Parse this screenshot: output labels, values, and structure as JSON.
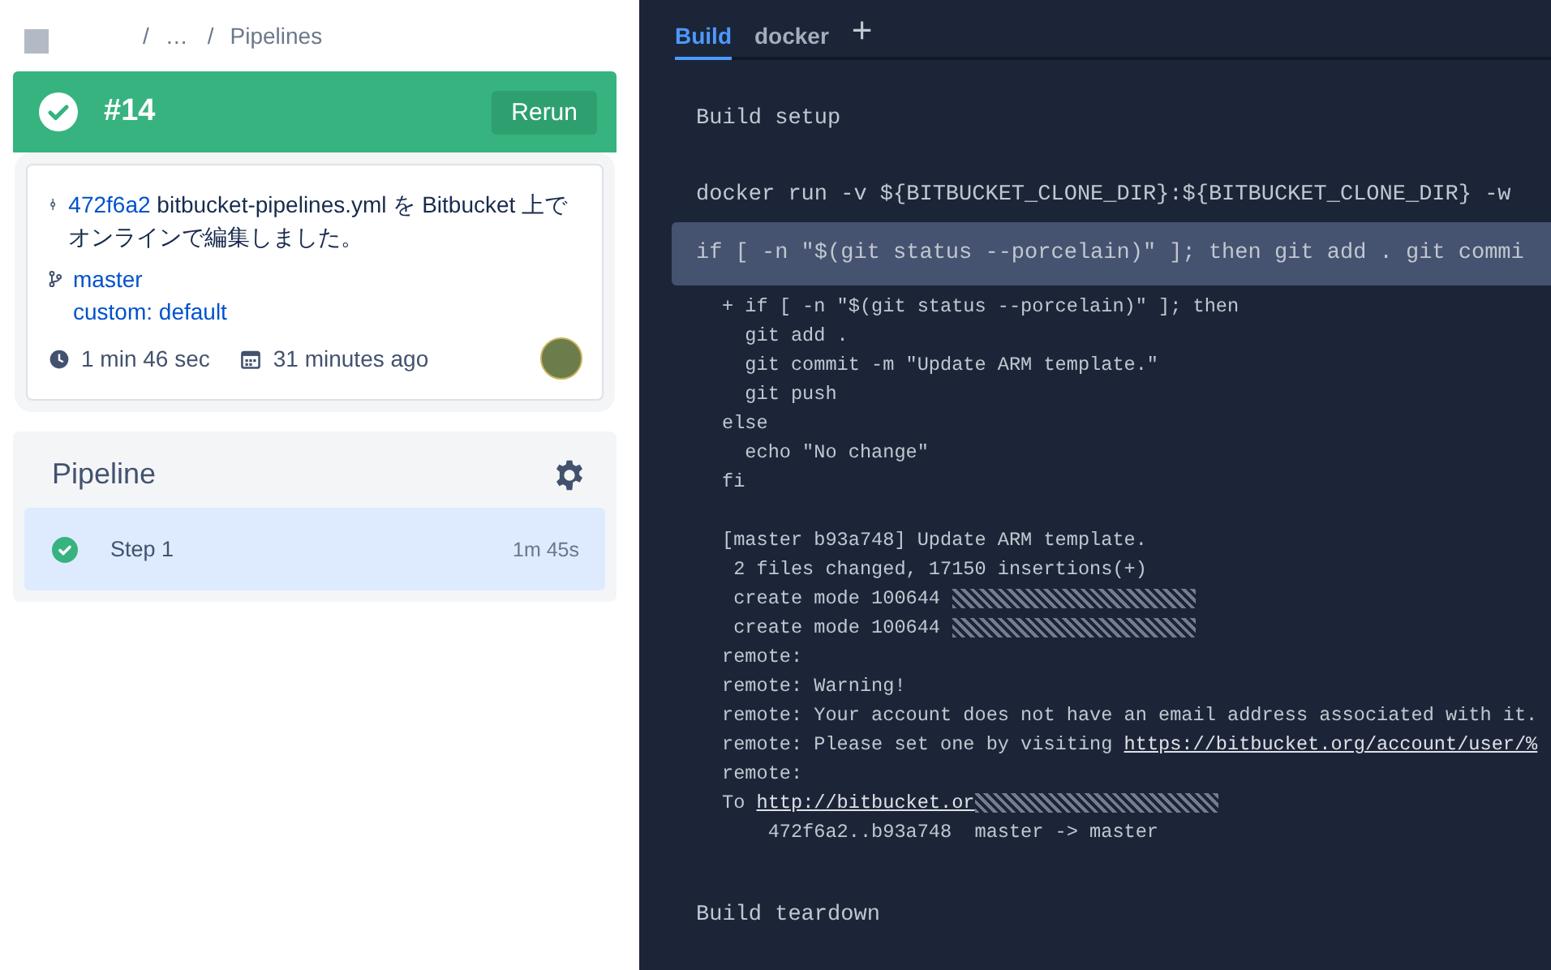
{
  "breadcrumb": {
    "separator": "/",
    "items": [
      "…",
      "Pipelines"
    ]
  },
  "build": {
    "passed": true,
    "number": "#14",
    "rerun": "Rerun"
  },
  "commit": {
    "hash": "472f6a2",
    "message": "bitbucket-pipelines.yml を Bitbucket 上でオンラインで編集しました。",
    "branch": "master",
    "pipeline": "custom: default",
    "duration": "1 min 46 sec",
    "time": "31 minutes ago"
  },
  "pipeline": {
    "title": "Pipeline",
    "steps": [
      {
        "name": "Step 1",
        "duration": "1m 45s",
        "passed": true,
        "selected": true
      }
    ]
  },
  "tabs": [
    {
      "label": "Build",
      "selected": true
    },
    {
      "label": "docker",
      "selected": false
    }
  ],
  "add_tab": "+",
  "log": {
    "setup": "Build setup",
    "teardown": "Build teardown",
    "commands": [
      {
        "text": "docker run -v ${BITBUCKET_CLONE_DIR}:${BITBUCKET_CLONE_DIR} -w",
        "expanded": false
      },
      {
        "text": "if [ -n \"$(git status --porcelain)\" ]; then git add . git commi",
        "expanded": true,
        "output": [
          [
            {
              "text": "+ if [ -n \"$(git status --porcelain)\" ]; then"
            },
            {
              "text": "  git add ."
            },
            {
              "text": "  git commit -m \"Update ARM template.\""
            },
            {
              "text": "  git push"
            },
            {
              "text": "else"
            },
            {
              "text": "  echo \"No change\""
            },
            {
              "text": "fi"
            }
          ],
          [
            {
              "text": "[master b93a748] Update ARM template."
            },
            {
              "text": " 2 files changed, 17150 insertions(+)"
            },
            {
              "text": " create mode 100644 ",
              "redacted": true
            },
            {
              "text": " create mode 100644 ",
              "redacted": true
            },
            {
              "text": "remote:"
            },
            {
              "text": "remote: Warning!"
            },
            {
              "text": "remote: Your account does not have an email address associated with it."
            },
            {
              "text": "remote: Please set one by visiting ",
              "link": "https://bitbucket.org/account/user/%"
            },
            {
              "text": "remote:"
            },
            {
              "text": "To ",
              "link": "http://bitbucket.or",
              "redacted": true
            },
            {
              "text": "    472f6a2..b93a748  master -> master"
            }
          ]
        ]
      }
    ]
  }
}
